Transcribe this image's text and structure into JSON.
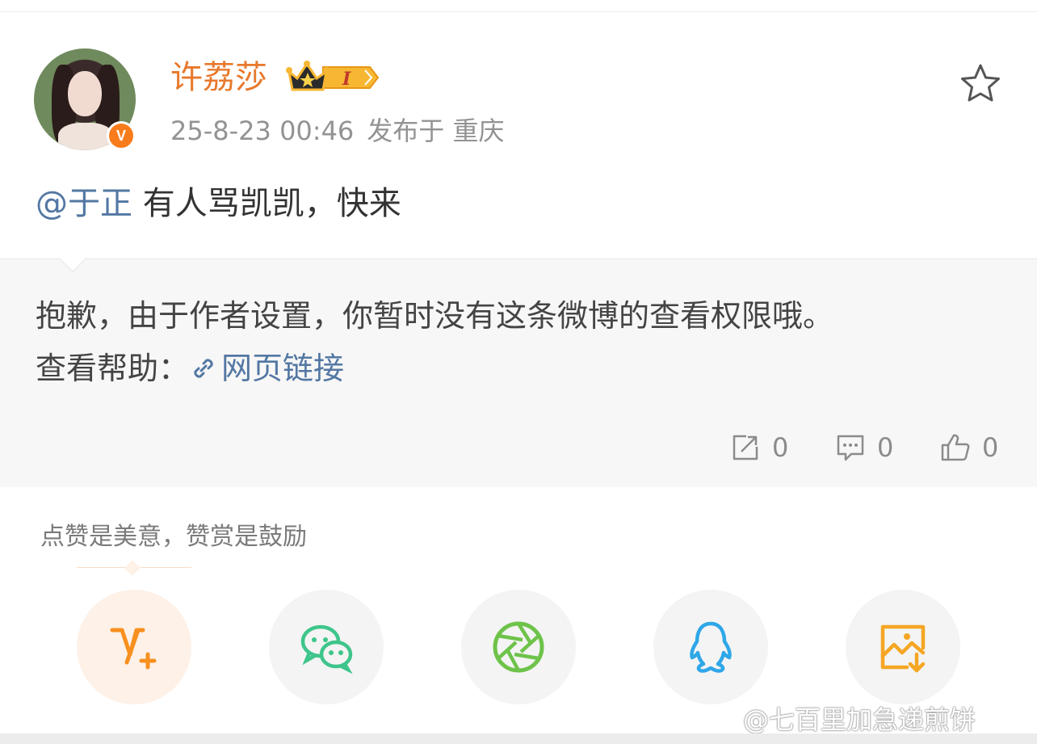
{
  "post": {
    "username": "许荔莎",
    "vip_badge": "I",
    "verified_badge": "V",
    "timestamp": "25-8-23 00:46",
    "location": "发布于 重庆",
    "mention": "@于正",
    "text": "有人骂凯凯，快来"
  },
  "notice": {
    "message": "抱歉，由于作者设置，你暂时没有这条微博的查看权限哦。",
    "help_label": "查看帮助：",
    "help_link": "网页链接"
  },
  "stats": {
    "reposts": "0",
    "comments": "0",
    "likes": "0"
  },
  "reward": {
    "prompt": "点赞是美意，赞赏是鼓励"
  },
  "share": {
    "icons": [
      "vplus-icon",
      "wechat-icon",
      "moments-icon",
      "qq-icon",
      "save-image-icon"
    ]
  },
  "watermark": "@七百里加急递煎饼",
  "colors": {
    "username": "#e8792c",
    "link": "#5377a3",
    "verified": "#f97c1c",
    "vplus": "#f7901e",
    "wechat": "#3ec58b",
    "moments": "#6ec34a",
    "qq": "#2ea7e8",
    "save": "#f5a623"
  }
}
